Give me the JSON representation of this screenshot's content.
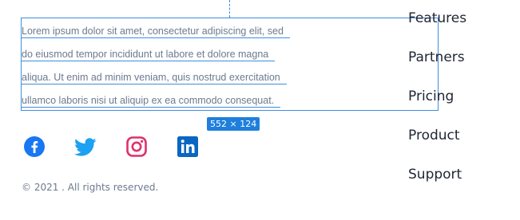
{
  "selection": {
    "size_label": "552 × 124"
  },
  "description": {
    "lines": [
      "Lorem ipsum dolor sit amet, consectetur adipiscing elit, sed",
      "do eiusmod tempor incididunt ut labore et dolore magna",
      "aliqua. Ut enim ad minim veniam, quis nostrud exercitation",
      "ullamco laboris nisi ut aliquip ex ea commodo consequat."
    ]
  },
  "nav": {
    "items": [
      "Features",
      "Partners",
      "Pricing",
      "Product",
      "Support"
    ]
  },
  "social": [
    {
      "icon": "facebook-icon",
      "color": "#1877f2"
    },
    {
      "icon": "twitter-icon",
      "color": "#1da1f2"
    },
    {
      "icon": "instagram-icon",
      "color": "#e1306c"
    },
    {
      "icon": "linkedin-icon",
      "color": "#0a66c2"
    }
  ],
  "footer": {
    "copyright": "© 2021 . All rights reserved."
  }
}
